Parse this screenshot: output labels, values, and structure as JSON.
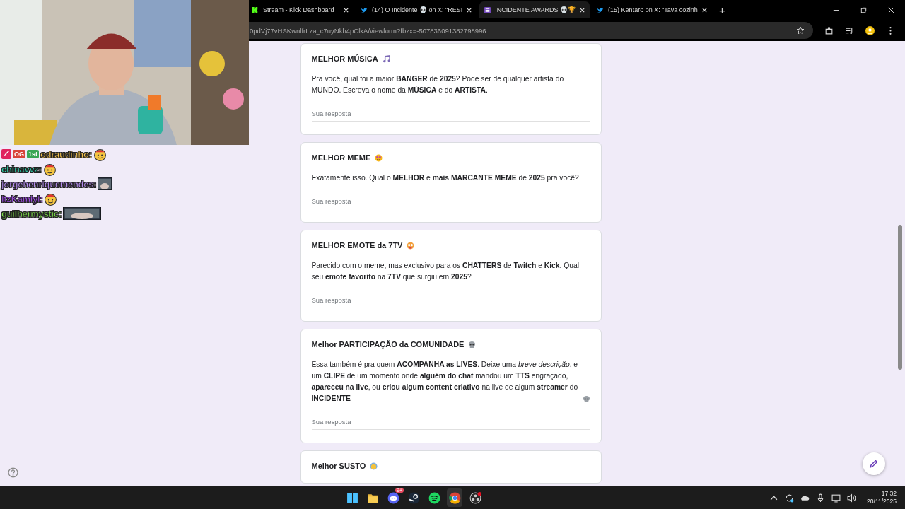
{
  "browser": {
    "tabs": [
      {
        "title": "Stream - Kick Dashboard",
        "kind": "kick",
        "selected": false
      },
      {
        "title": "(14) O Incidente 💀 on X: \"RESI",
        "kind": "bird",
        "selected": false
      },
      {
        "title": "INCIDENTE AWARDS 💀🏆",
        "kind": "form",
        "selected": true
      },
      {
        "title": "(15) Kentaro on X: \"Tava cozinh",
        "kind": "bird",
        "selected": false
      }
    ],
    "new_tab": "+",
    "address": "0pdVj77vHSKwnlfrLza_c7uyNkh4pClkA/viewform?fbzx=-507836091382798996"
  },
  "chat": [
    {
      "name": "odraudinho:",
      "color": "#f2c14e",
      "badges": [
        {
          "kind": "rocket"
        },
        {
          "kind": "text",
          "text": "OG",
          "color": "#d9443a"
        },
        {
          "kind": "text",
          "text": "1st",
          "color": "#3aa655"
        }
      ],
      "emote": {
        "kind": "smiley"
      }
    },
    {
      "name": "chinavvz:",
      "color": "#2fd6b0",
      "emote": {
        "kind": "smiley"
      }
    },
    {
      "name": "jorgehenriquemendes:",
      "color": "#b58cf0"
    },
    {
      "name": "ItzKamiyl:",
      "color": "#a24de8",
      "emote": {
        "kind": "smiley"
      }
    },
    {
      "name": "guilhermystic:",
      "color": "#7ee04a"
    }
  ],
  "questions": [
    {
      "title": "MELHOR MÚSICA",
      "kind": "music",
      "description": "Pra você, qual foi a maior **BANGER** de **2025**? Pode ser de qualquer artista do MUNDO. Escreva o nome da **MÚSICA** e do **ARTISTA**.",
      "placeholder": "Sua resposta"
    },
    {
      "title": "MELHOR MEME",
      "kind": "meme",
      "description": "Exatamente isso. Qual o **MELHOR** e **mais MARCANTE MEME** de **2025** pra você?",
      "placeholder": "Sua resposta"
    },
    {
      "title": "MELHOR EMOTE da 7TV",
      "kind": "emote",
      "description": "Parecido com o meme, mas exclusivo para os **CHATTERS** de **Twitch** e **Kick**. Qual seu **emote favorito** na **7TV** que surgiu em **2025**?",
      "placeholder": "Sua resposta"
    },
    {
      "title": "Melhor PARTICIPAÇÃO da COMUNIDADE",
      "kind": "skull",
      "description": "Essa também é pra quem **ACOMPANHA as LIVES**. Deixe uma *breve descrição*, e um **CLIPE** de um momento onde **alguém do chat** mandou um **TTS** engraçado, **apareceu na live**, ou **criou algum content criativo** na live de algum **streamer** do **INCIDENTE**",
      "trailing": {
        "kind": "skull"
      },
      "placeholder": "Sua resposta"
    },
    {
      "title": "Melhor SUSTO",
      "kind": "scared"
    }
  ],
  "taskbar": {
    "apps": [
      {
        "kind": "windows",
        "active": false
      },
      {
        "kind": "folder",
        "active": false
      },
      {
        "kind": "discord",
        "active": false,
        "badge": "9+"
      },
      {
        "kind": "steam",
        "active": false
      },
      {
        "kind": "spotify",
        "active": false
      },
      {
        "kind": "chrome",
        "active": true
      },
      {
        "kind": "obs",
        "active": false
      }
    ],
    "time": "17:32",
    "date": "20/11/2025"
  }
}
